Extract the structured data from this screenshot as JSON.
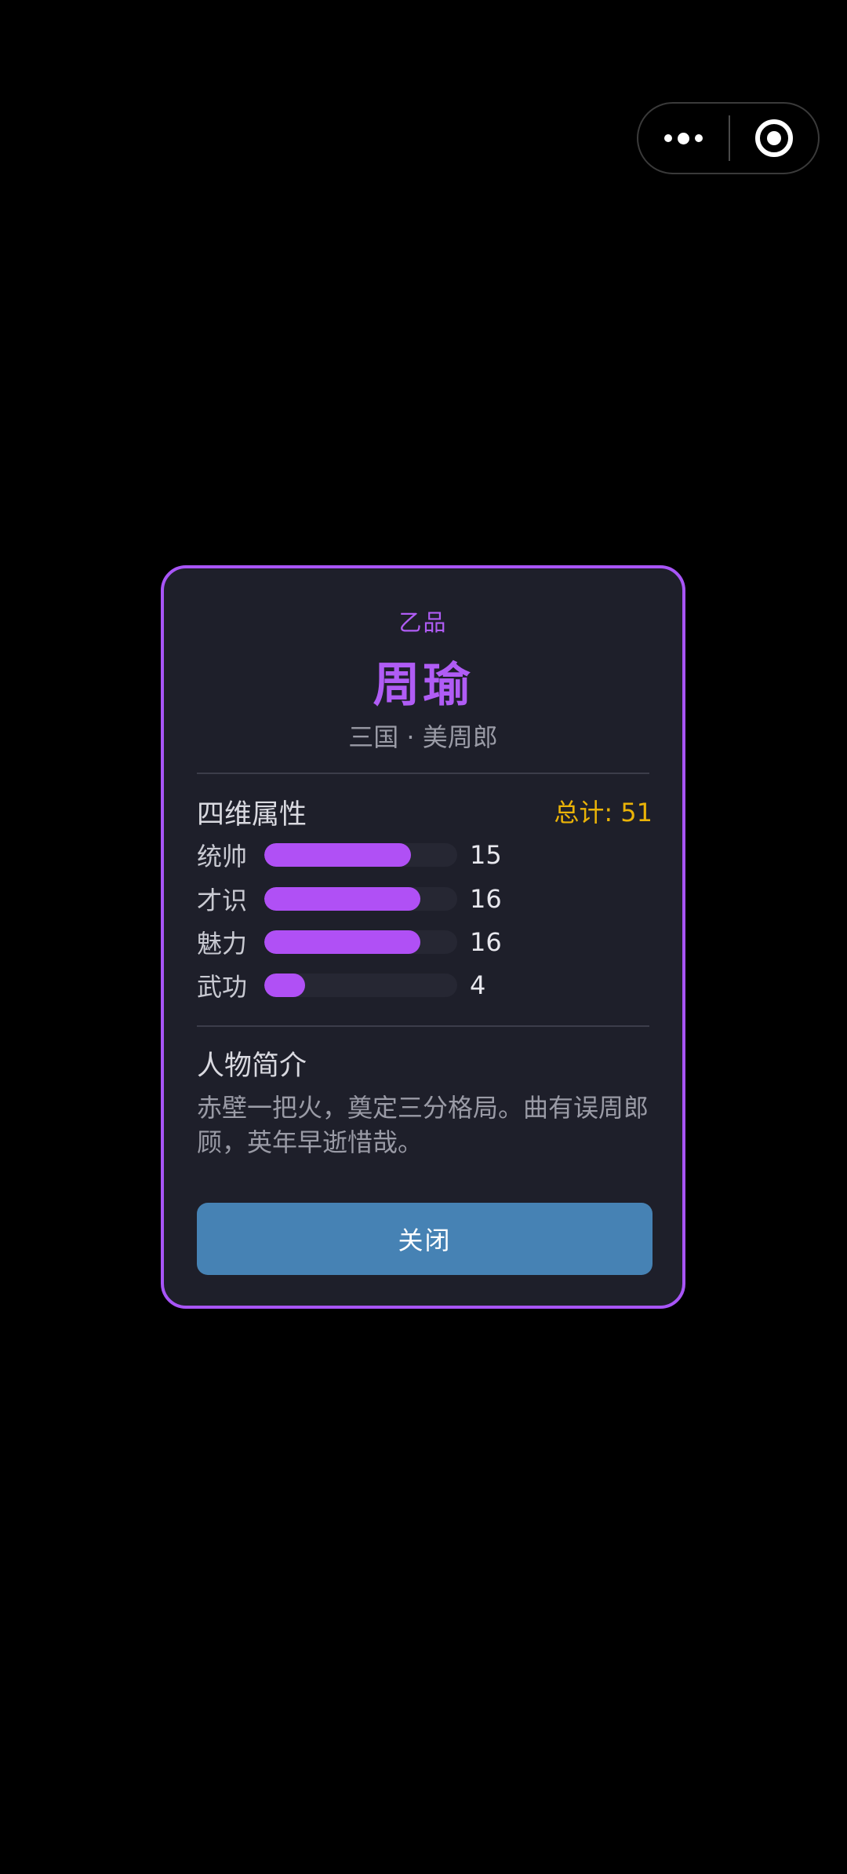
{
  "capsule": {
    "more_icon": "more-dots-icon",
    "close_icon": "target-circle-icon"
  },
  "card": {
    "grade": "乙品",
    "name": "周瑜",
    "subtitle": "三国 · 美周郎",
    "attributes": {
      "title": "四维属性",
      "total_label": "总计: 51",
      "items": [
        {
          "label": "统帅",
          "value": "15",
          "fill_fraction": 0.76
        },
        {
          "label": "才识",
          "value": "16",
          "fill_fraction": 0.81
        },
        {
          "label": "魅力",
          "value": "16",
          "fill_fraction": 0.81
        },
        {
          "label": "武功",
          "value": "4",
          "fill_fraction": 0.21
        }
      ]
    },
    "bio": {
      "title": "人物简介",
      "text": "赤壁一把火，奠定三分格局。曲有误周郎顾，英年早逝惜哉。"
    },
    "close_label": "关闭"
  },
  "colors": {
    "accent_purple": "#a855f7",
    "total_gold": "#eab308",
    "button_blue": "#4682b4",
    "card_bg": "#1e1f2a"
  }
}
